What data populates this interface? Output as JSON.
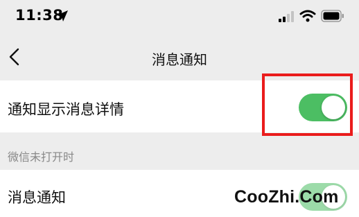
{
  "status_bar": {
    "time": "11:38",
    "icons": [
      "location-arrow-icon",
      "cellular-signal-icon",
      "wifi-icon",
      "battery-icon"
    ]
  },
  "nav": {
    "back_icon": "chevron-left-icon",
    "title": "消息通知"
  },
  "settings": {
    "show_details": {
      "label": "通知显示消息详情",
      "enabled": true
    },
    "section_header": "微信未打开时",
    "message_notification": {
      "label": "消息通知",
      "enabled": true
    }
  },
  "colors": {
    "toggle_on": "#4cbe63",
    "highlight": "#ea1c1c",
    "background": "#ededed",
    "row_background": "#ffffff"
  },
  "watermark": "CooZhi.Com"
}
